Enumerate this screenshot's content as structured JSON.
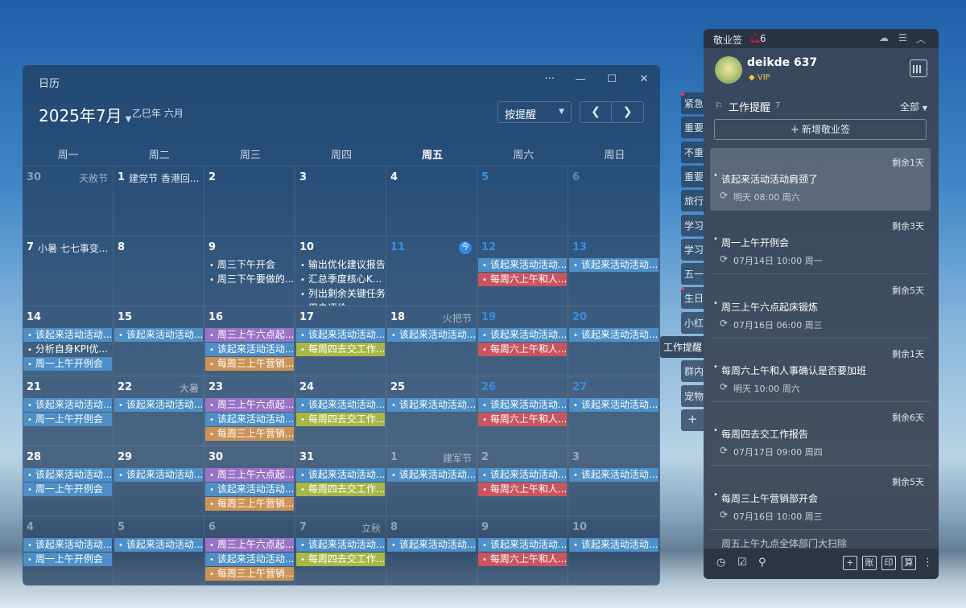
{
  "calendar": {
    "window_title": "日历",
    "month_title": "2025年7月",
    "lunar": "乙巳年 六月",
    "mode": "按提醒",
    "weekdays": [
      "周一",
      "周二",
      "周三",
      "周四",
      "周五",
      "周六",
      "周日"
    ],
    "today_weekday_index": 4,
    "today_badge": "今",
    "weeks": [
      [
        {
          "d": "30",
          "other": true,
          "note_r": "天赦节"
        },
        {
          "d": "1",
          "note": "建党节 香港回..."
        },
        {
          "d": "2"
        },
        {
          "d": "3"
        },
        {
          "d": "4"
        },
        {
          "d": "5",
          "blue": true
        },
        {
          "d": "6",
          "blue": true
        }
      ],
      [
        {
          "d": "7",
          "note": "小暑 七七事变..."
        },
        {
          "d": "8"
        },
        {
          "d": "9",
          "events": [
            {
              "t": "周三下午开会",
              "c": "plain"
            },
            {
              "t": "周三下午要做的...",
              "c": "plain"
            }
          ]
        },
        {
          "d": "10",
          "events": [
            {
              "t": "输出优化建议报告",
              "c": "plain"
            },
            {
              "t": "汇总季度核心K...",
              "c": "plain"
            },
            {
              "t": "列出剩余关键任务",
              "c": "plain"
            },
            {
              "t": "用户评价",
              "c": "plain"
            }
          ]
        },
        {
          "d": "11",
          "blue": true,
          "today": true
        },
        {
          "d": "12",
          "blue": true,
          "events": [
            {
              "t": "该起来活动活动...",
              "c": "blue"
            },
            {
              "t": "每周六上午和人...",
              "c": "red"
            }
          ]
        },
        {
          "d": "13",
          "blue": true,
          "events": [
            {
              "t": "该起来活动活动...",
              "c": "blue"
            }
          ]
        }
      ],
      [
        {
          "d": "14",
          "events": [
            {
              "t": "该起来活动活动...",
              "c": "blue"
            },
            {
              "t": "分析自身KPI优...",
              "c": "dark"
            },
            {
              "t": "周一上午开例会",
              "c": "blue"
            }
          ]
        },
        {
          "d": "15",
          "events": [
            {
              "t": "该起来活动活动...",
              "c": "blue"
            }
          ]
        },
        {
          "d": "16",
          "events": [
            {
              "t": "周三上午六点起...",
              "c": "purple"
            },
            {
              "t": "该起来活动活动...",
              "c": "blue"
            },
            {
              "t": "每周三上午营销...",
              "c": "orange"
            }
          ]
        },
        {
          "d": "17",
          "events": [
            {
              "t": "该起来活动活动...",
              "c": "blue"
            },
            {
              "t": "每周四去交工作...",
              "c": "green"
            }
          ]
        },
        {
          "d": "18",
          "note_r": "火把节",
          "events": [
            {
              "t": "该起来活动活动...",
              "c": "blue"
            }
          ]
        },
        {
          "d": "19",
          "blue": true,
          "events": [
            {
              "t": "该起来活动活动...",
              "c": "blue"
            },
            {
              "t": "每周六上午和人...",
              "c": "red"
            }
          ]
        },
        {
          "d": "20",
          "blue": true,
          "events": [
            {
              "t": "该起来活动活动...",
              "c": "blue"
            }
          ]
        }
      ],
      [
        {
          "d": "21",
          "events": [
            {
              "t": "该起来活动活动...",
              "c": "blue"
            },
            {
              "t": "周一上午开例会",
              "c": "blue"
            }
          ]
        },
        {
          "d": "22",
          "note_r": "大暑",
          "events": [
            {
              "t": "该起来活动活动...",
              "c": "blue"
            }
          ]
        },
        {
          "d": "23",
          "events": [
            {
              "t": "周三上午六点起...",
              "c": "purple"
            },
            {
              "t": "该起来活动活动...",
              "c": "blue"
            },
            {
              "t": "每周三上午营销...",
              "c": "orange"
            }
          ]
        },
        {
          "d": "24",
          "events": [
            {
              "t": "该起来活动活动...",
              "c": "blue"
            },
            {
              "t": "每周四去交工作...",
              "c": "green"
            }
          ]
        },
        {
          "d": "25",
          "events": [
            {
              "t": "该起来活动活动...",
              "c": "blue"
            }
          ]
        },
        {
          "d": "26",
          "blue": true,
          "events": [
            {
              "t": "该起来活动活动...",
              "c": "blue"
            },
            {
              "t": "每周六上午和人...",
              "c": "red"
            }
          ]
        },
        {
          "d": "27",
          "blue": true,
          "events": [
            {
              "t": "该起来活动活动...",
              "c": "blue"
            }
          ]
        }
      ],
      [
        {
          "d": "28",
          "events": [
            {
              "t": "该起来活动活动...",
              "c": "blue"
            },
            {
              "t": "周一上午开例会",
              "c": "blue"
            }
          ]
        },
        {
          "d": "29",
          "events": [
            {
              "t": "该起来活动活动...",
              "c": "blue"
            }
          ]
        },
        {
          "d": "30",
          "events": [
            {
              "t": "周三上午六点起...",
              "c": "purple"
            },
            {
              "t": "该起来活动活动...",
              "c": "blue"
            },
            {
              "t": "每周三上午营销...",
              "c": "orange"
            }
          ]
        },
        {
          "d": "31",
          "events": [
            {
              "t": "该起来活动活动...",
              "c": "blue"
            },
            {
              "t": "每周四去交工作...",
              "c": "green"
            }
          ]
        },
        {
          "d": "1",
          "other": true,
          "note_r": "建军节",
          "events": [
            {
              "t": "该起来活动活动...",
              "c": "blue"
            }
          ]
        },
        {
          "d": "2",
          "other": true,
          "blue": true,
          "events": [
            {
              "t": "该起来活动活动...",
              "c": "blue"
            },
            {
              "t": "每周六上午和人...",
              "c": "red"
            }
          ]
        },
        {
          "d": "3",
          "other": true,
          "blue": true,
          "events": [
            {
              "t": "该起来活动活动...",
              "c": "blue"
            }
          ]
        }
      ],
      [
        {
          "d": "4",
          "other": true,
          "events": [
            {
              "t": "该起来活动活动...",
              "c": "blue"
            },
            {
              "t": "周一上午开例会",
              "c": "blue"
            }
          ]
        },
        {
          "d": "5",
          "other": true,
          "events": [
            {
              "t": "该起来活动活动...",
              "c": "blue"
            }
          ]
        },
        {
          "d": "6",
          "other": true,
          "events": [
            {
              "t": "周三上午六点起...",
              "c": "purple"
            },
            {
              "t": "该起来活动活动...",
              "c": "blue"
            },
            {
              "t": "每周三上午营销...",
              "c": "orange"
            }
          ]
        },
        {
          "d": "7",
          "other": true,
          "note_r": "立秋",
          "events": [
            {
              "t": "该起来活动活动...",
              "c": "blue"
            },
            {
              "t": "每周四去交工作...",
              "c": "green"
            }
          ]
        },
        {
          "d": "8",
          "other": true,
          "events": [
            {
              "t": "该起来活动活动...",
              "c": "blue"
            }
          ]
        },
        {
          "d": "9",
          "other": true,
          "blue": true,
          "events": [
            {
              "t": "该起来活动活动...",
              "c": "blue"
            },
            {
              "t": "每周六上午和人...",
              "c": "red"
            }
          ]
        },
        {
          "d": "10",
          "other": true,
          "blue": true,
          "events": [
            {
              "t": "该起来活动活动...",
              "c": "blue"
            }
          ]
        }
      ]
    ]
  },
  "side_tabs": [
    {
      "label": "紧急",
      "dot": true
    },
    {
      "label": "重要"
    },
    {
      "label": "不重"
    },
    {
      "label": "重要"
    },
    {
      "label": "旅行"
    },
    {
      "label": "学习"
    },
    {
      "label": "学习"
    },
    {
      "label": "五一"
    },
    {
      "label": "生日",
      "dot": true
    },
    {
      "label": "小红"
    },
    {
      "label": "工作提醒",
      "active": true
    },
    {
      "label": "群内"
    },
    {
      "label": "宠物"
    },
    {
      "label": "+"
    }
  ],
  "panel": {
    "app_name": "敬业签",
    "alert_count": "6",
    "user_name": "deikde 637",
    "vip": "VIP",
    "section_title": "工作提醒",
    "section_count": "7",
    "filter": "全部",
    "add_label": "新增敬业签",
    "notes": [
      {
        "remain": "剩余1天",
        "title": "该起来活动活动肩颈了",
        "time": "明天 08:00 周六",
        "selected": true
      },
      {
        "remain": "剩余3天",
        "title": "周一上午开例会",
        "time": "07月14日 10:00 周一"
      },
      {
        "remain": "剩余5天",
        "title": "周三上午六点起床锻炼",
        "time": "07月16日 06:00 周三"
      },
      {
        "remain": "剩余1天",
        "title": "每周六上午和人事确认是否要加班",
        "time": "明天 10:00 周六"
      },
      {
        "remain": "剩余6天",
        "title": "每周四去交工作报告",
        "time": "07月17日 09:00 周四"
      },
      {
        "remain": "剩余5天",
        "title": "每周三上午营销部开会",
        "time": "07月16日 10:00 周三"
      }
    ],
    "partial_note": "周五上午九点全体部门大扫除",
    "bottom_icons": {
      "clock": "◷",
      "check": "☑",
      "search": "⚲",
      "add": "+",
      "account": "账",
      "print": "印",
      "calc": "算",
      "more": "⋮"
    }
  }
}
